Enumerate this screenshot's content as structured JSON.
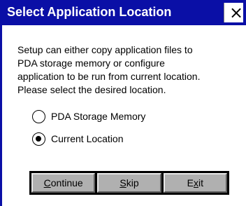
{
  "dialog": {
    "title": "Select Application Location",
    "close_glyph": "×",
    "close_icon": "close-icon",
    "colors": {
      "titlebar": "#0a0fa6",
      "title_text": "#ffffff",
      "button_face": "#b0b0b0"
    }
  },
  "message": {
    "lines": [
      "Setup can either copy application files to",
      "PDA storage memory or configure",
      "application to be run from current location.",
      "Please select the desired location."
    ]
  },
  "options": [
    {
      "label": "PDA Storage Memory",
      "selected": false
    },
    {
      "label": "Current Location",
      "selected": true
    }
  ],
  "buttons": {
    "continue": {
      "accel": "C",
      "rest": "ontinue"
    },
    "skip": {
      "accel": "S",
      "rest": "kip"
    },
    "exit": {
      "pre": "E",
      "accel": "x",
      "rest": "it"
    }
  }
}
